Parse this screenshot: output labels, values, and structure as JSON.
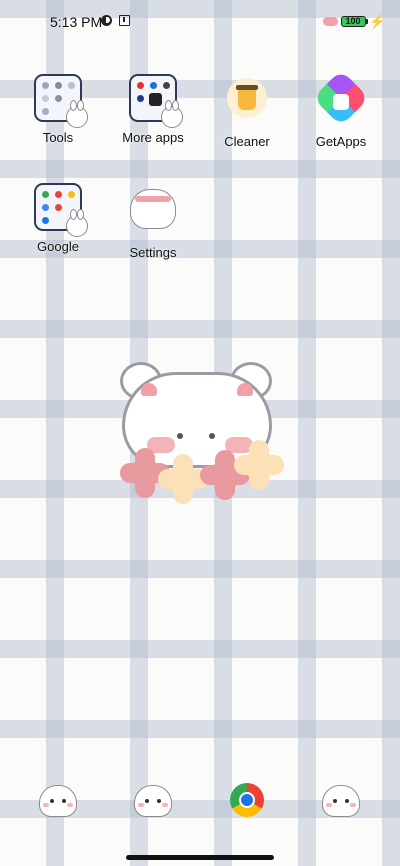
{
  "status_bar": {
    "time": "5:13 PM",
    "battery_level": "100",
    "icons": [
      "data-saver-icon",
      "sim-icon",
      "cloud-icon",
      "battery-icon",
      "charging-bolt-icon"
    ]
  },
  "home_apps": [
    {
      "label": "Tools",
      "icon": "tools-folder-icon"
    },
    {
      "label": "More apps",
      "icon": "more-apps-folder-icon"
    },
    {
      "label": "Cleaner",
      "icon": "cleaner-icon"
    },
    {
      "label": "GetApps",
      "icon": "getapps-icon"
    },
    {
      "label": "Google",
      "icon": "google-folder-icon"
    },
    {
      "label": "Settings",
      "icon": "settings-icon"
    }
  ],
  "dock": [
    {
      "icon": "phone-bear-icon"
    },
    {
      "icon": "contacts-bunny-icon"
    },
    {
      "icon": "chrome-icon"
    },
    {
      "icon": "messages-bear-icon"
    }
  ],
  "colors": {
    "grid": "#aab5c9",
    "background": "#fbfbfa",
    "battery": "#39c75a",
    "accent_pink": "#f2a0a6"
  }
}
